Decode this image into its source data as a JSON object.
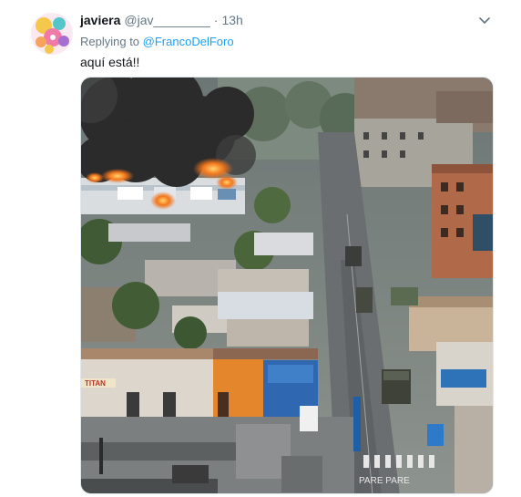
{
  "tweet": {
    "display_name": "javiera",
    "handle": "@jav________",
    "separator": "·",
    "time": "13h",
    "replying_prefix": "Replying to",
    "replying_to": "@FrancoDelForo",
    "text": "aquí está!!",
    "avatar_icon": "sticker-avatar-icon",
    "menu_icon": "chevron-down-icon",
    "media_description": "photo",
    "media_signs": {
      "storefront": "TITAN",
      "road_marking": "PARE PARE"
    }
  },
  "colors": {
    "link": "#1da1f2",
    "muted": "#657786",
    "text": "#14171a",
    "fire": "#f2761d",
    "smoke": "#2b2b2b"
  }
}
